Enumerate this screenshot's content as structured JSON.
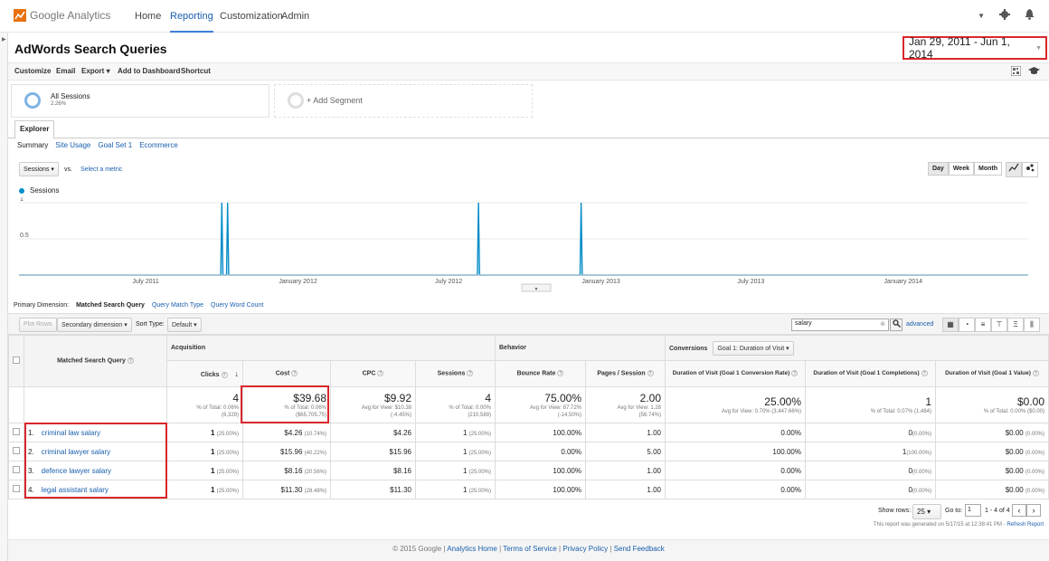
{
  "app": {
    "name": "Google Analytics"
  },
  "nav": {
    "home": "Home",
    "reporting": "Reporting",
    "customization": "Customization",
    "admin": "Admin"
  },
  "report": {
    "title": "AdWords Search Queries",
    "date_range": "Jan 29, 2011 - Jun 1, 2014"
  },
  "toolbar": {
    "customize": "Customize",
    "email": "Email",
    "export": "Export",
    "add_dashboard": "Add to Dashboard",
    "shortcut": "Shortcut"
  },
  "segments": {
    "all_sessions": "All Sessions",
    "all_sessions_pct": "2.26%",
    "add_segment": "+ Add Segment"
  },
  "tabs": {
    "explorer": "Explorer"
  },
  "subtabs": [
    "Summary",
    "Site Usage",
    "Goal Set 1",
    "Ecommerce"
  ],
  "chart_controls": {
    "metric": "Sessions",
    "vs": "vs.",
    "select_metric": "Select a metric",
    "day": "Day",
    "week": "Week",
    "month": "Month"
  },
  "chart_data": {
    "type": "line",
    "series": [
      {
        "name": "Sessions",
        "color": "#058dc7",
        "spikes": [
          "2011-10",
          "2011-10",
          "2012-08",
          "2012-12"
        ],
        "spike_value": 1
      }
    ],
    "yticks": [
      "1",
      "0.5"
    ],
    "xticks": [
      "July 2011",
      "January 2012",
      "July 2012",
      "January 2013",
      "July 2013",
      "January 2014"
    ],
    "ylim": [
      0,
      1
    ]
  },
  "dimension": {
    "label": "Primary Dimension:",
    "current": "Matched Search Query",
    "opt1": "Query Match Type",
    "opt2": "Query Word Count"
  },
  "tablebar": {
    "plot_rows": "Plot Rows",
    "secondary": "Secondary dimension",
    "sort_label": "Sort Type:",
    "sort_value": "Default",
    "search_value": "salary",
    "advanced": "advanced"
  },
  "table": {
    "col_query": "Matched Search Query",
    "group_acq": "Acquisition",
    "group_beh": "Behavior",
    "group_conv": "Conversions",
    "goal_select": "Goal 1: Duration of Visit",
    "headers": [
      "Clicks",
      "Cost",
      "CPC",
      "Sessions",
      "Bounce Rate",
      "Pages / Session",
      "Duration of Visit (Goal 1 Conversion Rate)",
      "Duration of Visit (Goal 1 Completions)",
      "Duration of Visit (Goal 1 Value)"
    ],
    "totals": [
      {
        "big": "4",
        "s1": "% of Total: 0.06%",
        "s2": "(6,329)"
      },
      {
        "big": "$39.68",
        "s1": "% of Total: 0.06%",
        "s2": "($65,705.75)"
      },
      {
        "big": "$9.92",
        "s1": "Avg for View: $10.38",
        "s2": "(-4.45%)"
      },
      {
        "big": "4",
        "s1": "% of Total: 0.00%",
        "s2": "(210,589)"
      },
      {
        "big": "75.00%",
        "s1": "Avg for View: 87.72%",
        "s2": "(-14.50%)"
      },
      {
        "big": "2.00",
        "s1": "Avg for View: 1.28",
        "s2": "(56.74%)"
      },
      {
        "big": "25.00%",
        "s1": "Avg for View: 0.70% (3,447.66%)",
        "s2": ""
      },
      {
        "big": "1",
        "s1": "% of Total: 0.07% (1,484)",
        "s2": ""
      },
      {
        "big": "$0.00",
        "s1": "% of Total: 0.00% ($0.00)",
        "s2": ""
      }
    ],
    "rows": [
      {
        "n": "1.",
        "q": "criminal law salary",
        "clicks": "1",
        "clicks_p": "(25.00%)",
        "cost": "$4.26",
        "cost_p": "(10.74%)",
        "cpc": "$4.26",
        "sess": "1",
        "sess_p": "(25.00%)",
        "bounce": "100.00%",
        "pps": "1.00",
        "cr": "0.00%",
        "comp": "0",
        "comp_p": "(0.00%)",
        "val": "$0.00",
        "val_p": "(0.00%)"
      },
      {
        "n": "2.",
        "q": "criminal lawyer salary",
        "clicks": "1",
        "clicks_p": "(25.00%)",
        "cost": "$15.96",
        "cost_p": "(40.22%)",
        "cpc": "$15.96",
        "sess": "1",
        "sess_p": "(25.00%)",
        "bounce": "0.00%",
        "pps": "5.00",
        "cr": "100.00%",
        "comp": "1",
        "comp_p": "(100.00%)",
        "val": "$0.00",
        "val_p": "(0.00%)"
      },
      {
        "n": "3.",
        "q": "defence lawyer salary",
        "clicks": "1",
        "clicks_p": "(25.00%)",
        "cost": "$8.16",
        "cost_p": "(20.56%)",
        "cpc": "$8.16",
        "sess": "1",
        "sess_p": "(25.00%)",
        "bounce": "100.00%",
        "pps": "1.00",
        "cr": "0.00%",
        "comp": "0",
        "comp_p": "(0.00%)",
        "val": "$0.00",
        "val_p": "(0.00%)"
      },
      {
        "n": "4.",
        "q": "legal assistant salary",
        "clicks": "1",
        "clicks_p": "(25.00%)",
        "cost": "$11.30",
        "cost_p": "(28.48%)",
        "cpc": "$11.30",
        "sess": "1",
        "sess_p": "(25.00%)",
        "bounce": "100.00%",
        "pps": "1.00",
        "cr": "0.00%",
        "comp": "0",
        "comp_p": "(0.00%)",
        "val": "$0.00",
        "val_p": "(0.00%)"
      }
    ]
  },
  "pagination": {
    "show_rows": "Show rows:",
    "rows": "25",
    "goto": "Go to:",
    "page": "1",
    "range": "1 - 4 of 4"
  },
  "generated": {
    "text": "This report was generated on 5/17/15 at 12:38:41 PM -",
    "refresh": "Refresh Report"
  },
  "footer": {
    "copyright": "© 2015 Google",
    "sep": " | ",
    "home": "Analytics Home",
    "terms": "Terms of Service",
    "privacy": "Privacy Policy",
    "feedback": "Send Feedback"
  }
}
